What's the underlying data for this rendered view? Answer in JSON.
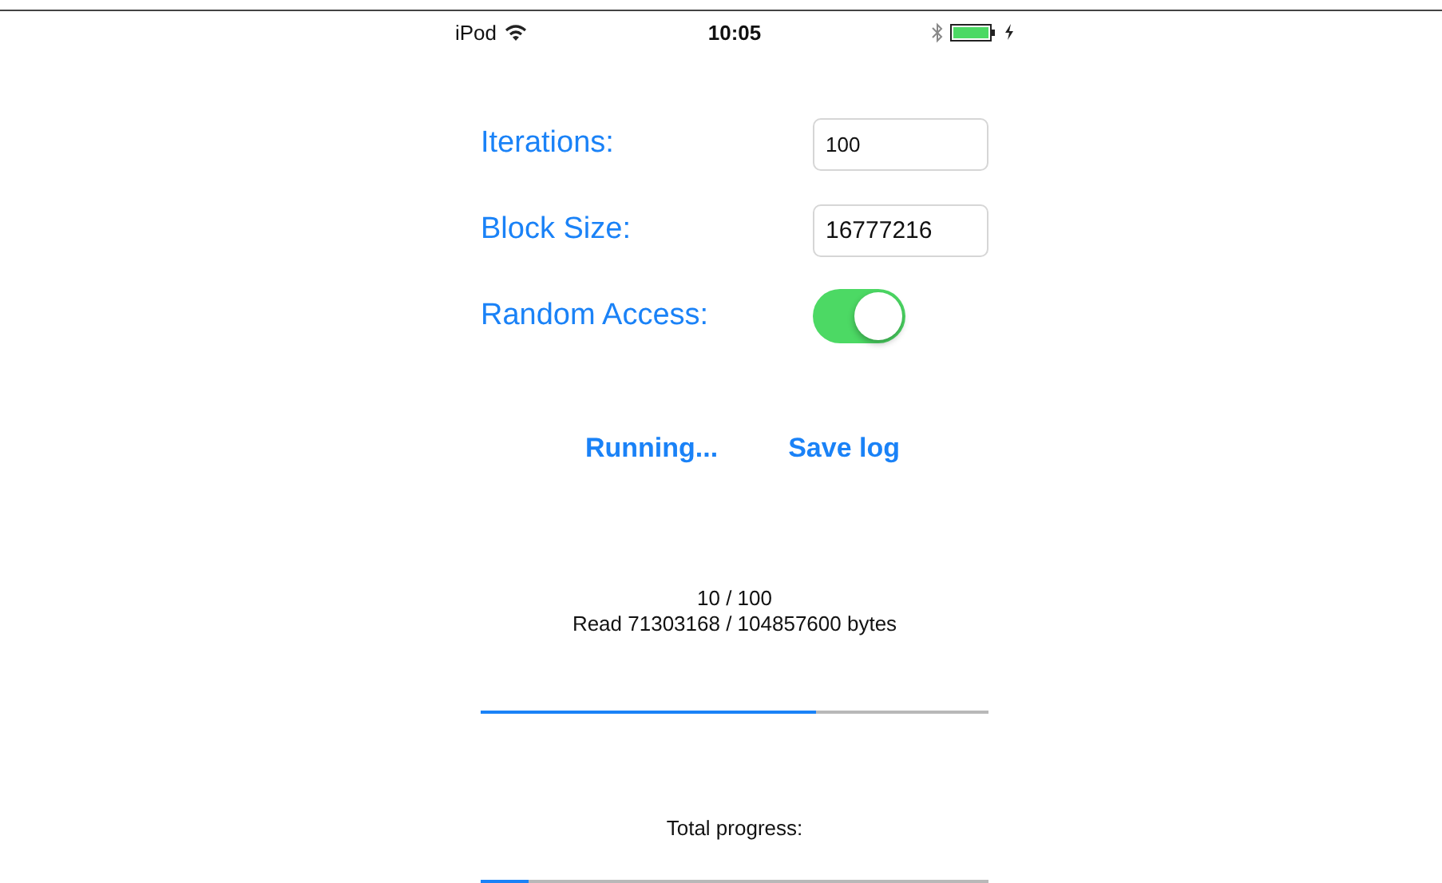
{
  "status_bar": {
    "device": "iPod",
    "time": "10:05"
  },
  "settings": [
    {
      "kind": "field",
      "label": "Iterations:",
      "value": "100"
    },
    {
      "kind": "field",
      "label": "Block Size:",
      "value": "16777216"
    },
    {
      "kind": "toggle",
      "label": "Random Access:",
      "on": true
    }
  ],
  "buttons": [
    {
      "label": "Running..."
    },
    {
      "label": "Save log"
    }
  ],
  "progress": {
    "iteration": "10 / 100",
    "bytes": "Read 71303168 / 104857600 bytes",
    "level": 0.66
  },
  "total": {
    "label": "Total progress:",
    "level": 0.095
  }
}
